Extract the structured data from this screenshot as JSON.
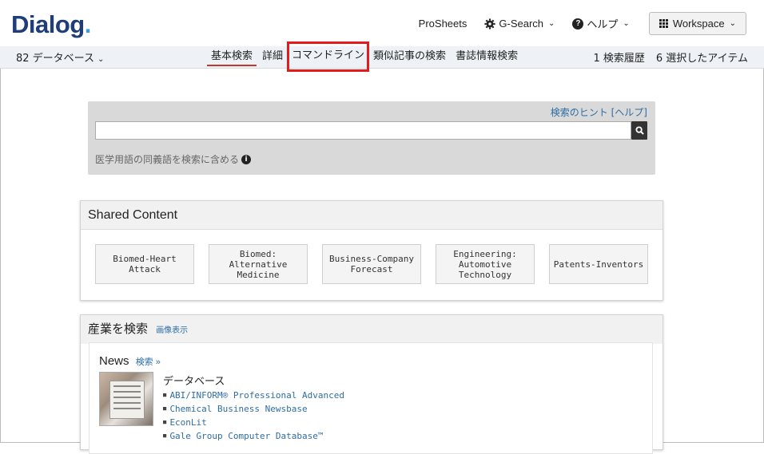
{
  "header": {
    "logo_main": "Dialog",
    "logo_dot": ".",
    "prosheets": "ProSheets",
    "gsearch": "G-Search",
    "help": "ヘルプ",
    "workspace": "Workspace"
  },
  "nav": {
    "db_count": "82 データベース",
    "tabs": [
      "基本検索",
      "詳細",
      "コマンドライン",
      "類似記事の検索",
      "書誌情報検索"
    ],
    "history": "1 検索履歴",
    "selected": "6 選択したアイテム"
  },
  "search": {
    "tips": "検索のヒント",
    "help": "[ヘルプ]",
    "value": "",
    "synonym_label": "医学用語の同義語を検索に含める"
  },
  "shared": {
    "title": "Shared Content",
    "cards": [
      "Biomed-Heart Attack",
      "Biomed: Alternative Medicine",
      "Business-Company Forecast",
      "Engineering: Automotive Technology",
      "Patents-Inventors"
    ]
  },
  "industry": {
    "title": "産業を検索",
    "image_view": "画像表示",
    "news_title": "News",
    "news_search": "検索 »",
    "db_label": "データベース",
    "databases": [
      "ABI/INFORM® Professional Advanced",
      "Chemical Business Newsbase",
      "EconLit",
      "Gale Group Computer Database™"
    ]
  },
  "colors": {
    "accent_red": "#e41b1b",
    "link_blue": "#2e6da4",
    "logo_blue": "#1f3d7a"
  }
}
